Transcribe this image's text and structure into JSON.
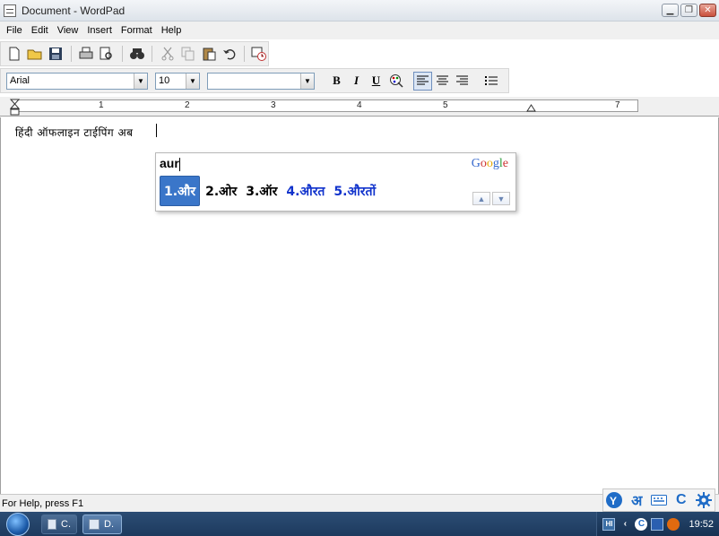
{
  "window": {
    "title": "Document - WordPad",
    "minimize": "▁",
    "maximize": "❐",
    "close": "✕"
  },
  "menu": [
    "File",
    "Edit",
    "View",
    "Insert",
    "Format",
    "Help"
  ],
  "toolbar": {
    "icons": [
      "new-icon",
      "open-icon",
      "save-icon",
      "print-icon",
      "print-preview-icon",
      "find-icon",
      "cut-icon",
      "copy-icon",
      "paste-icon",
      "undo-icon",
      "insert-date-time-icon"
    ]
  },
  "format": {
    "font": "Arial",
    "size": "10",
    "script": "",
    "bold": "B",
    "italic": "I",
    "underline": "U"
  },
  "ruler": {
    "numbers": [
      "1",
      "2",
      "3",
      "4",
      "5",
      "7"
    ]
  },
  "document": {
    "text": "हिंदी ऑफलाइन टाईपिंग अब"
  },
  "ime": {
    "input": "aur",
    "logo": "Google",
    "candidates": [
      {
        "label": "1.और",
        "style": "selected"
      },
      {
        "label": "2.ओर",
        "style": "normal"
      },
      {
        "label": "3.ऑर",
        "style": "normal"
      },
      {
        "label": "4.औरत",
        "style": "blue"
      },
      {
        "label": "5.औरतों",
        "style": "blue"
      }
    ]
  },
  "status": {
    "help": "For Help, press F1"
  },
  "langbar": {
    "hindi_char": "अ",
    "c_char": "C"
  },
  "taskbar": {
    "task1": "C.",
    "task2": "D.",
    "tray_lang": "HI",
    "time": "19:52"
  },
  "colors": {
    "selected_candidate": "#3a76c9",
    "blue_candidate": "#1133cc",
    "taskbar": "#1d3a5e"
  }
}
